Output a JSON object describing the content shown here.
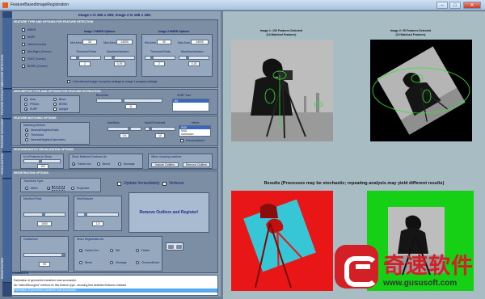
{
  "window": {
    "title": "FeatureBasedImageRegistration",
    "controls": [
      "–",
      "□",
      "✕"
    ]
  },
  "sidebar": {
    "sections": [
      "FEATURE DETECTION",
      "FEATURE EXTRACTION",
      "FEATURE MATCHING",
      "VISUALIZATION",
      "REGISTRATION"
    ]
  },
  "banner": "Image 1 is 256 x 256; Image 2 is 165 x 165.",
  "detection": {
    "title": "FEATURE TYPE AND OPTIONS FOR FEATURE DETECTION",
    "types": [
      "MSER",
      "SURF",
      "Harris (Corner)",
      "Min Eigen (Corner)",
      "FAST (Corner)",
      "BRISK (Corner)"
    ],
    "image1_title": "Image 1 MSER Options",
    "image2_title": "Image 2 MSER Options",
    "min_area_label": "Min Area",
    "max_area_label": "Max Area",
    "img1_min_area": "30",
    "img1_max_area": "14000",
    "img2_min_area": "30",
    "img2_max_area": "14000",
    "threshold_delta_label": "Threshold Delta",
    "max_area_variation_label": "MaxAreaVariation",
    "img1_delta": "2",
    "img1_variation": "0.25",
    "img2_delta": "2",
    "img2_variation": "0.25",
    "link_label": "Link relevant image 2 property settings to image 1 property settings"
  },
  "extraction": {
    "title": "DESCRIPTOR TYPE AND OPTIONS FOR FEATURE EXTRACTION",
    "types": [
      "Auto",
      "Block",
      "FREAK",
      "BRISK",
      "SURF",
      "Upright"
    ],
    "block_size_label": "BlockSize",
    "block_size_value": "11",
    "surf_size_label": "SURF Size",
    "surf_size_value": "64"
  },
  "matching": {
    "title": "FEATURE MATCHING OPTIONS",
    "method_label": "Matching Method",
    "methods": [
      "NearestNeighborRatio",
      "Threshold",
      "NearestNeighborSymmetric"
    ],
    "max_ratio_label": "MaxRatio",
    "max_ratio_value": "0.6",
    "match_threshold_label": "MatchThreshold",
    "match_threshold_value": "10",
    "metric_label": "Metric",
    "metrics": [
      "SSD",
      "SAD",
      "normxcorr"
    ],
    "prenormalized_label": "Prenormalized"
  },
  "visualization": {
    "title": "FEATURE/MATCH VISUALIZATION OPTIONS",
    "num_features_label": "N of Features to Show",
    "num_features_value": "100",
    "show_matches_label": "Show Matched Features As",
    "show_options": [
      "FalseColor",
      "Blend",
      "Montage"
    ],
    "when_showing_label": "When showing matches:",
    "include_outliers_button": "Include Outliers",
    "remove_outliers_button": "Remove Outliers"
  },
  "registration": {
    "title": "REGISTRATION OPTIONS",
    "transform_label": "Transform Type",
    "transforms": [
      "Affine",
      "Similarity",
      "Projective"
    ],
    "update_label": "Update Immediately",
    "verbose_label": "Verbose",
    "max_num_trials_label": "MaxNumTrials",
    "max_num_trials_value": "1000",
    "max_distance_label": "MaxDistance",
    "max_distance_value": "1.5",
    "confidence_label": "Confidence",
    "confidence_value": "99",
    "show_reg_label": "Show Registration As",
    "show_reg_options": [
      "FalseColor",
      "Diff",
      "Flicker",
      "Blend",
      "Montage",
      "CheckerBoard"
    ],
    "remove_button": "Remove Outliers and Register!"
  },
  "comments": {
    "title": "COMMENTS",
    "lines": [
      "Estimation of geometric transform was successful.",
      "No \"selectStrongest\" method for this feature type...showing first detected features instead!",
      "Estimation of geometric transform was successful."
    ]
  },
  "images": {
    "image1_caption": "Image 1: 100 Features Detected",
    "image1_subcaption": "(14 Matched Features)",
    "image2_caption": "Image 2: 95 Features Detected",
    "image2_subcaption": "(14 Matched Features)",
    "results": "Results (Processes may be stochastic; repeating analysis may yield different results)"
  },
  "watermark": {
    "brand": "奇速软件",
    "url": "www.gususoft.com"
  }
}
